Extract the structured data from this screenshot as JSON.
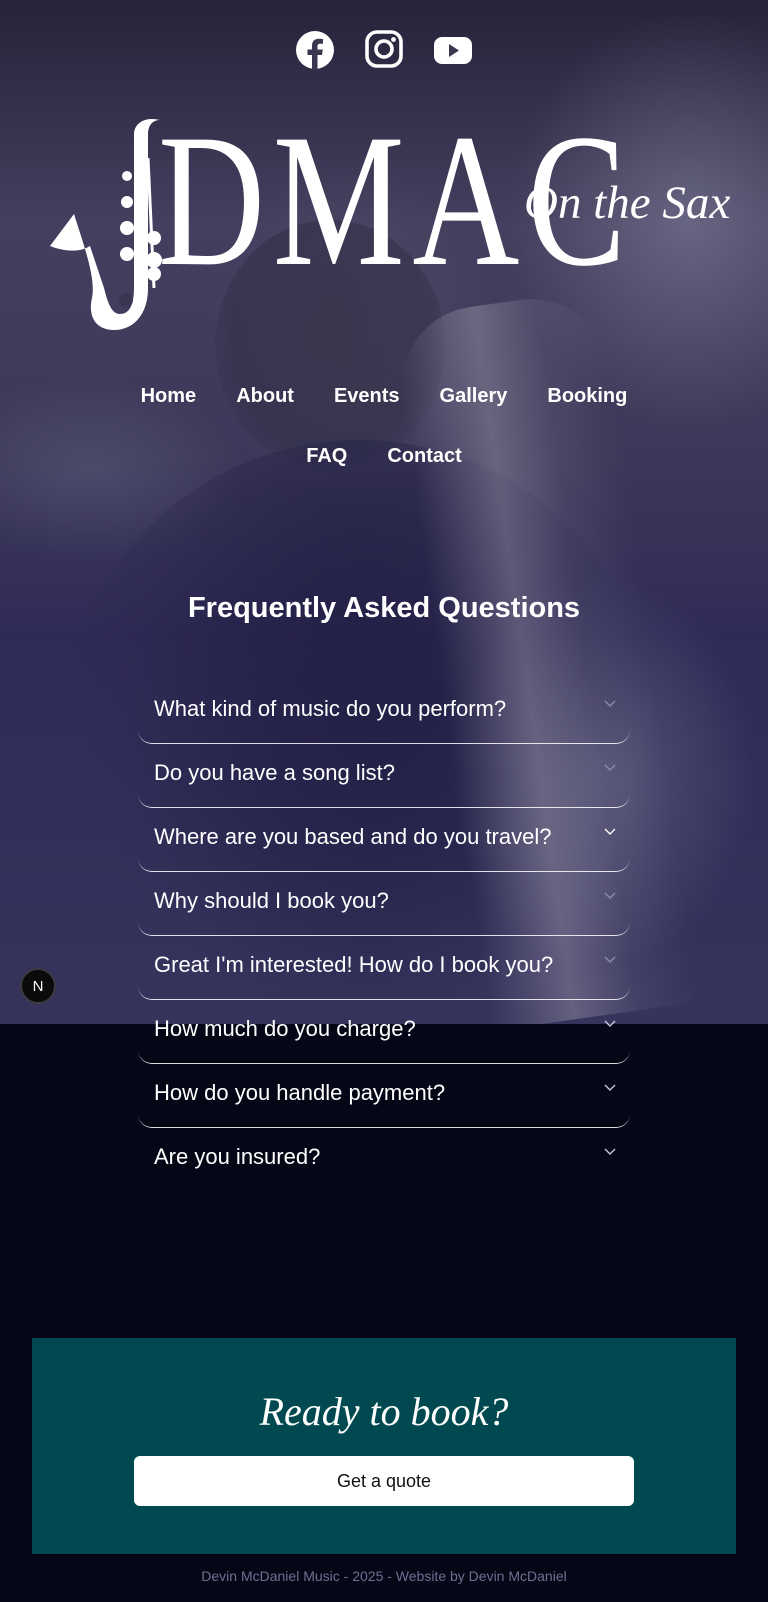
{
  "social": [
    {
      "name": "facebook-icon",
      "label": "Facebook"
    },
    {
      "name": "instagram-icon",
      "label": "Instagram"
    },
    {
      "name": "youtube-icon",
      "label": "YouTube"
    }
  ],
  "logo": {
    "letters": "DMAC",
    "subtitle": "On the Sax"
  },
  "nav": {
    "items": [
      "Home",
      "About",
      "Events",
      "Gallery",
      "Booking",
      "FAQ",
      "Contact"
    ]
  },
  "faq": {
    "title": "Frequently Asked Questions",
    "questions": [
      "What kind of music do you perform?",
      "Do you have a song list?",
      "Where are you based and do you travel?",
      "Why should I book you?",
      "Great I'm interested! How do I book you?",
      "How much do you charge?",
      "How do you handle payment?",
      "Are you insured?"
    ],
    "chevron_icon": "chevron-down-icon"
  },
  "badge": {
    "letter": "N"
  },
  "cta": {
    "title": "Ready to book?",
    "button_label": "Get a quote"
  },
  "footer": {
    "text": "Devin McDaniel Music - 2025 - Website by Devin McDaniel"
  },
  "colors": {
    "page_bg": "#050616",
    "cta_bg": "#004950",
    "footer_text": "#6d7090",
    "hero_tint": "#322f5a"
  }
}
